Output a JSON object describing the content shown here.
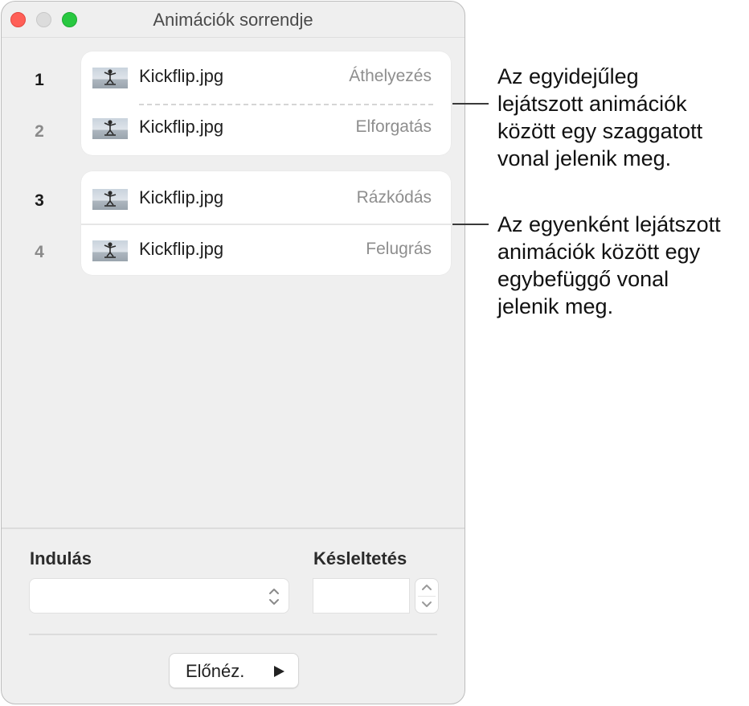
{
  "window": {
    "title": "Animációk sorrendje"
  },
  "groups": [
    {
      "separator": "dashed",
      "items": [
        {
          "number": "1",
          "file": "Kickflip.jpg",
          "animation": "Áthelyezés"
        },
        {
          "number": "2",
          "file": "Kickflip.jpg",
          "animation": "Elforgatás"
        }
      ]
    },
    {
      "separator": "solid",
      "items": [
        {
          "number": "3",
          "file": "Kickflip.jpg",
          "animation": "Rázkódás"
        },
        {
          "number": "4",
          "file": "Kickflip.jpg",
          "animation": "Felugrás"
        }
      ]
    }
  ],
  "controls": {
    "start_label": "Indulás",
    "start_value": "",
    "delay_label": "Késleltetés",
    "delay_value": "",
    "preview_label": "Előnéz."
  },
  "icons": {
    "thumbnail": "kickflip-photo-thumbnail",
    "popup_arrows": "chevron-up-down-icon",
    "stepper_up": "chevron-up-icon",
    "stepper_down": "chevron-down-icon",
    "play": "play-icon"
  },
  "callouts": [
    {
      "lines": [
        "Az egyidejűleg",
        "lejátszott animációk",
        "között egy szaggatott",
        "vonal jelenik meg."
      ]
    },
    {
      "lines": [
        "Az egyenként lejátszott",
        "animációk között egy",
        "egybefüggő vonal",
        "jelenik meg."
      ]
    }
  ],
  "colors": {
    "close": "#ff5f57",
    "minimize": "#dcdcdc",
    "zoom": "#28c840"
  }
}
